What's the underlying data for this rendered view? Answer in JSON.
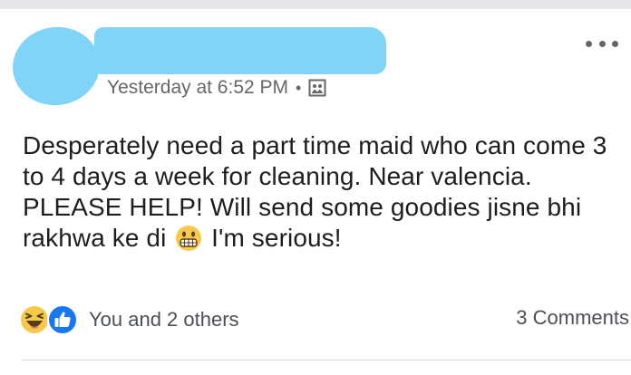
{
  "post": {
    "author": {
      "avatar_icon": "redacted-avatar",
      "name_redacted": true
    },
    "timestamp": "Yesterday at 6:52 PM",
    "separator": "•",
    "audience_icon": "photo-audience-icon",
    "more_icon": "more-options-icon",
    "text": {
      "part1": "Desperately need a part time maid who can come 3 to 4 days a week for cleaning. Near valencia. PLEASE HELP! Will send some goodies jisne bhi rakhwa ke di",
      "emoji": "grimacing-face-emoji",
      "part2": "I'm serious!"
    },
    "reactions": {
      "icons": [
        "haha-reaction-icon",
        "like-reaction-icon"
      ],
      "label": "You and 2 others"
    },
    "comments_label": "3 Comments"
  },
  "colors": {
    "redaction": "#80d4f7",
    "meta_text": "#65676b",
    "like_blue": "#1877f2",
    "haha_yellow": "#f7c94b"
  }
}
